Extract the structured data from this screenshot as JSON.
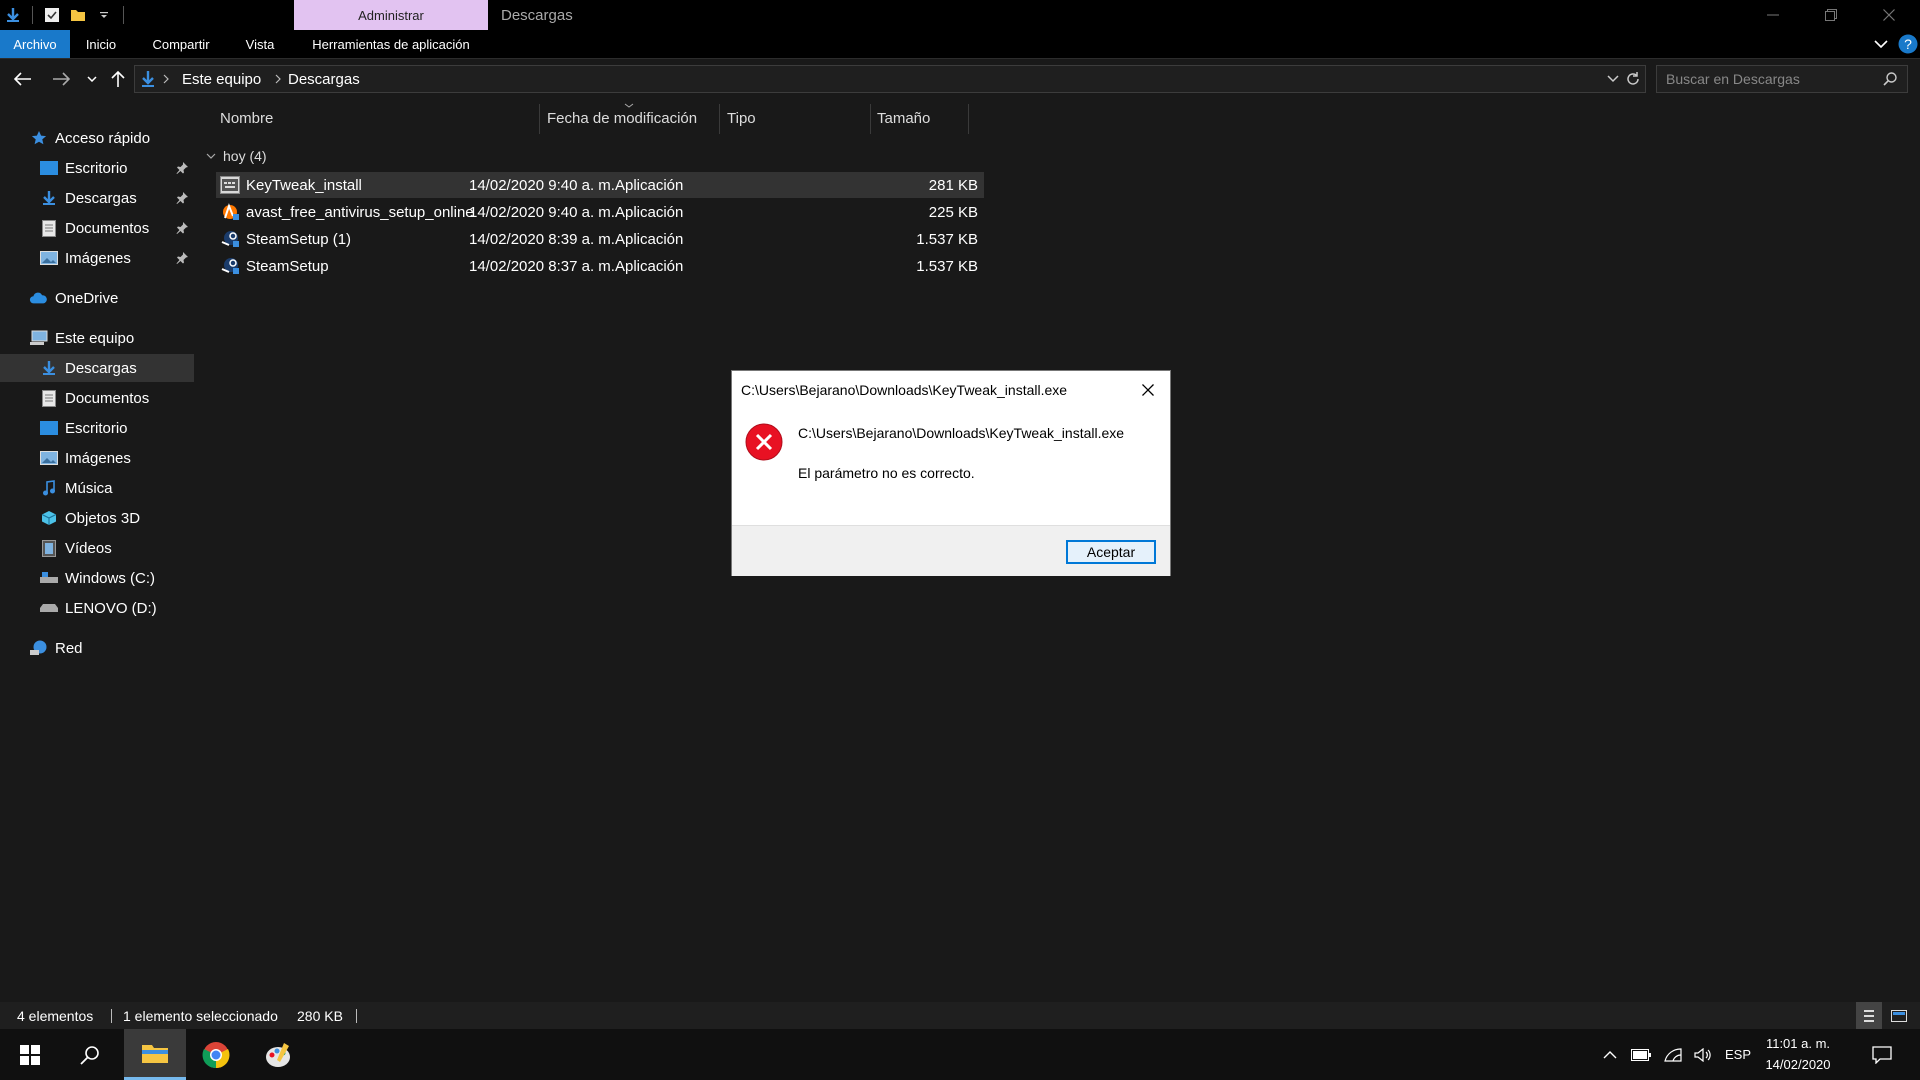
{
  "window": {
    "contextual_tab": "Administrar",
    "title": "Descargas"
  },
  "ribbon": {
    "tabs": [
      {
        "label": "Archivo"
      },
      {
        "label": "Inicio"
      },
      {
        "label": "Compartir"
      },
      {
        "label": "Vista"
      },
      {
        "label": "Herramientas de aplicación"
      }
    ]
  },
  "address": {
    "crumbs": [
      "Este equipo",
      "Descargas"
    ],
    "search_placeholder": "Buscar en Descargas"
  },
  "nav": {
    "quick_access": "Acceso rápido",
    "quick_items": [
      {
        "label": "Escritorio",
        "icon": "desktop-icon"
      },
      {
        "label": "Descargas",
        "icon": "download-icon"
      },
      {
        "label": "Documentos",
        "icon": "document-icon"
      },
      {
        "label": "Imágenes",
        "icon": "picture-icon"
      }
    ],
    "onedrive": "OneDrive",
    "this_pc": "Este equipo",
    "pc_items": [
      {
        "label": "Descargas",
        "icon": "download-icon"
      },
      {
        "label": "Documentos",
        "icon": "document-icon"
      },
      {
        "label": "Escritorio",
        "icon": "desktop-icon"
      },
      {
        "label": "Imágenes",
        "icon": "picture-icon"
      },
      {
        "label": "Música",
        "icon": "music-icon"
      },
      {
        "label": "Objetos 3D",
        "icon": "cube-icon"
      },
      {
        "label": "Vídeos",
        "icon": "video-icon"
      },
      {
        "label": "Windows (C:)",
        "icon": "drive-icon"
      },
      {
        "label": "LENOVO (D:)",
        "icon": "drive-icon"
      }
    ],
    "network": "Red"
  },
  "files": {
    "columns": [
      "Nombre",
      "Fecha de modificación",
      "Tipo",
      "Tamaño"
    ],
    "group": "hoy (4)",
    "rows": [
      {
        "name": "KeyTweak_install",
        "date": "14/02/2020 9:40 a. m.",
        "type": "Aplicación",
        "size": "281 KB",
        "icon": "installer-icon"
      },
      {
        "name": "avast_free_antivirus_setup_online",
        "date": "14/02/2020 9:40 a. m.",
        "type": "Aplicación",
        "size": "225 KB",
        "icon": "avast-icon"
      },
      {
        "name": "SteamSetup (1)",
        "date": "14/02/2020 8:39 a. m.",
        "type": "Aplicación",
        "size": "1.537 KB",
        "icon": "steam-icon"
      },
      {
        "name": "SteamSetup",
        "date": "14/02/2020 8:37 a. m.",
        "type": "Aplicación",
        "size": "1.537 KB",
        "icon": "steam-icon"
      }
    ]
  },
  "status": {
    "count": "4 elementos",
    "selection": "1 elemento seleccionado",
    "size": "280 KB"
  },
  "dialog": {
    "title": "C:\\Users\\Bejarano\\Downloads\\KeyTweak_install.exe",
    "path": "C:\\Users\\Bejarano\\Downloads\\KeyTweak_install.exe",
    "message": "El parámetro no es correcto.",
    "ok": "Aceptar"
  },
  "taskbar": {
    "lang": "ESP",
    "time": "11:01 a. m.",
    "date": "14/02/2020"
  },
  "colors": {
    "accent": "#1979ca",
    "contextual_tab": "#e2c3f1",
    "error": "#e81123",
    "background": "#191919"
  }
}
